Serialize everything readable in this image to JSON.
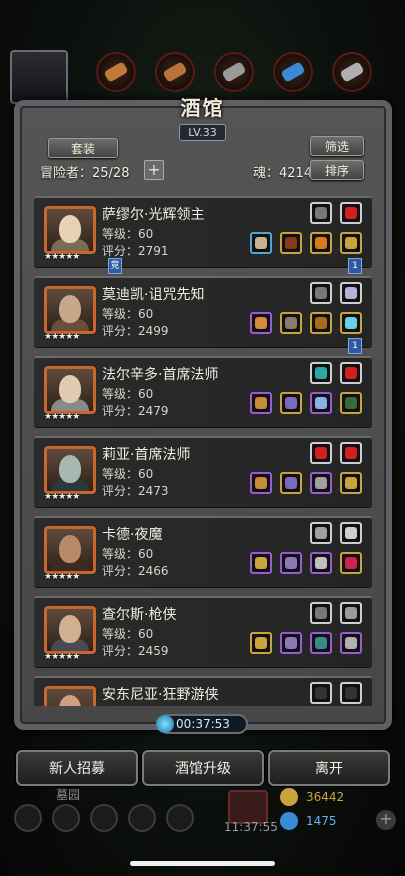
{
  "screen": {
    "title": "酒馆",
    "level_badge": "LV.33"
  },
  "header": {
    "set_button": "套装",
    "filter_button": "筛选",
    "adventurers_label": "冒险者：25/28",
    "add_label": "+",
    "soul_label": "魂：4214",
    "sort_button": "排序"
  },
  "heroes": [
    {
      "name": "萨缪尔·光辉领主",
      "level": "等级：60",
      "score": "评分：2791",
      "stars": "★★★★★",
      "tag": ""
    },
    {
      "name": "莫迪凯·诅咒先知",
      "level": "等级：60",
      "score": "评分：2499",
      "stars": "★★★★★",
      "tag": "1"
    },
    {
      "name": "法尔辛多·首席法师",
      "level": "等级：60",
      "score": "评分：2479",
      "stars": "★★★★★",
      "tag": "1"
    },
    {
      "name": "莉亚·首席法师",
      "level": "等级：60",
      "score": "评分：2473",
      "stars": "★★★★★",
      "tag": ""
    },
    {
      "name": "卡德·夜魔",
      "level": "等级：60",
      "score": "评分：2466",
      "stars": "★★★★★",
      "tag": ""
    },
    {
      "name": "查尔斯·枪侠",
      "level": "等级：60",
      "score": "评分：2459",
      "stars": "★★★★★",
      "tag": ""
    },
    {
      "name": "安东尼亚·狂野游侠",
      "level": "",
      "score": "",
      "stars": "",
      "tag": ""
    }
  ],
  "badges": {
    "hero1_tag": "竞"
  },
  "timer": "00:37:53",
  "actions": {
    "recruit": "新人招募",
    "upgrade": "酒馆升级",
    "leave": "离开"
  },
  "footer": {
    "area_label": "墓园",
    "clock": "11:37:55",
    "gold": "36442",
    "gems": "1475"
  },
  "colors": {
    "accent_orange": "#c8662e",
    "frame_gray": "#5f5f66"
  }
}
